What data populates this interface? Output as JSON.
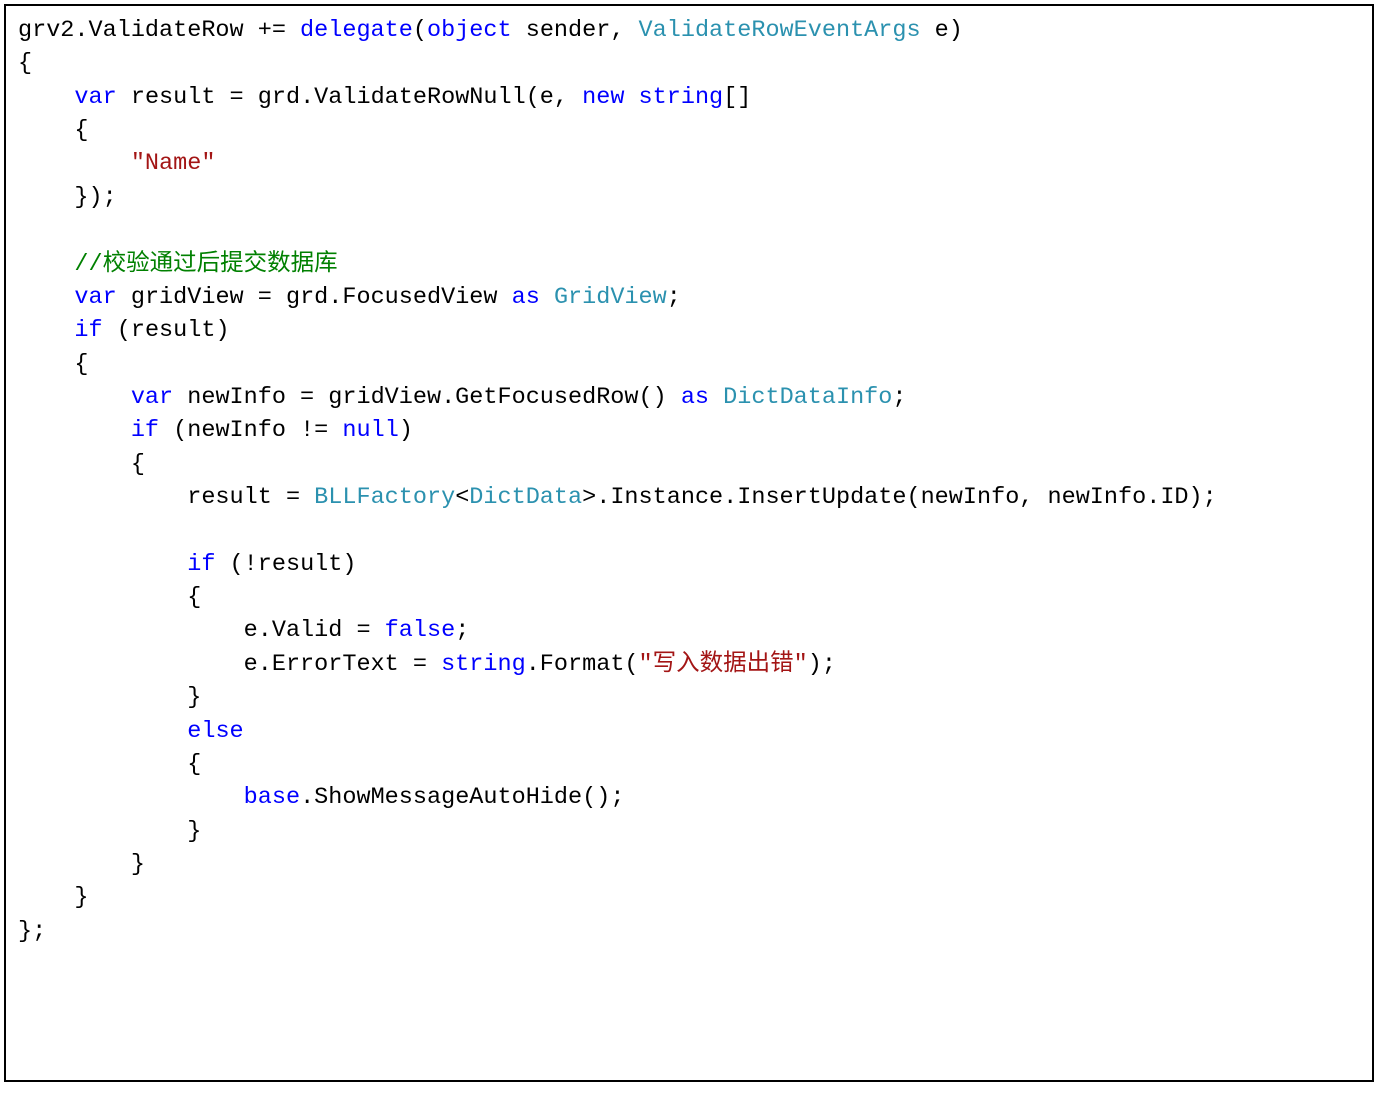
{
  "code": {
    "tokens": [
      [
        {
          "t": "grv2.ValidateRow += ",
          "c": ""
        },
        {
          "t": "delegate",
          "c": "kw"
        },
        {
          "t": "(",
          "c": ""
        },
        {
          "t": "object",
          "c": "kw"
        },
        {
          "t": " sender, ",
          "c": ""
        },
        {
          "t": "ValidateRowEventArgs",
          "c": "type"
        },
        {
          "t": " e)",
          "c": ""
        }
      ],
      [
        {
          "t": "{",
          "c": ""
        }
      ],
      [
        {
          "t": "    ",
          "c": ""
        },
        {
          "t": "var",
          "c": "kw"
        },
        {
          "t": " result = grd.ValidateRowNull(e, ",
          "c": ""
        },
        {
          "t": "new",
          "c": "kw"
        },
        {
          "t": " ",
          "c": ""
        },
        {
          "t": "string",
          "c": "kw"
        },
        {
          "t": "[]",
          "c": ""
        }
      ],
      [
        {
          "t": "    {",
          "c": ""
        }
      ],
      [
        {
          "t": "        ",
          "c": ""
        },
        {
          "t": "\"Name\"",
          "c": "str"
        }
      ],
      [
        {
          "t": "    });",
          "c": ""
        }
      ],
      [
        {
          "t": "",
          "c": ""
        }
      ],
      [
        {
          "t": "    ",
          "c": ""
        },
        {
          "t": "//校验通过后提交数据库",
          "c": "comment"
        }
      ],
      [
        {
          "t": "    ",
          "c": ""
        },
        {
          "t": "var",
          "c": "kw"
        },
        {
          "t": " gridView = grd.FocusedView ",
          "c": ""
        },
        {
          "t": "as",
          "c": "kw"
        },
        {
          "t": " ",
          "c": ""
        },
        {
          "t": "GridView",
          "c": "type"
        },
        {
          "t": ";",
          "c": ""
        }
      ],
      [
        {
          "t": "    ",
          "c": ""
        },
        {
          "t": "if",
          "c": "kw"
        },
        {
          "t": " (result)",
          "c": ""
        }
      ],
      [
        {
          "t": "    {",
          "c": ""
        }
      ],
      [
        {
          "t": "        ",
          "c": ""
        },
        {
          "t": "var",
          "c": "kw"
        },
        {
          "t": " newInfo = gridView.GetFocusedRow() ",
          "c": ""
        },
        {
          "t": "as",
          "c": "kw"
        },
        {
          "t": " ",
          "c": ""
        },
        {
          "t": "DictDataInfo",
          "c": "type"
        },
        {
          "t": ";",
          "c": ""
        }
      ],
      [
        {
          "t": "        ",
          "c": ""
        },
        {
          "t": "if",
          "c": "kw"
        },
        {
          "t": " (newInfo != ",
          "c": ""
        },
        {
          "t": "null",
          "c": "kw"
        },
        {
          "t": ")",
          "c": ""
        }
      ],
      [
        {
          "t": "        {",
          "c": ""
        }
      ],
      [
        {
          "t": "            result = ",
          "c": ""
        },
        {
          "t": "BLLFactory",
          "c": "type"
        },
        {
          "t": "<",
          "c": ""
        },
        {
          "t": "DictData",
          "c": "type"
        },
        {
          "t": ">.Instance.InsertUpdate(newInfo, newInfo.ID);",
          "c": ""
        }
      ],
      [
        {
          "t": "",
          "c": ""
        }
      ],
      [
        {
          "t": "            ",
          "c": ""
        },
        {
          "t": "if",
          "c": "kw"
        },
        {
          "t": " (!result)",
          "c": ""
        }
      ],
      [
        {
          "t": "            {",
          "c": ""
        }
      ],
      [
        {
          "t": "                e.Valid = ",
          "c": ""
        },
        {
          "t": "false",
          "c": "kw"
        },
        {
          "t": ";",
          "c": ""
        }
      ],
      [
        {
          "t": "                e.ErrorText = ",
          "c": ""
        },
        {
          "t": "string",
          "c": "kw"
        },
        {
          "t": ".Format(",
          "c": ""
        },
        {
          "t": "\"写入数据出错\"",
          "c": "str"
        },
        {
          "t": ");",
          "c": ""
        }
      ],
      [
        {
          "t": "            }",
          "c": ""
        }
      ],
      [
        {
          "t": "            ",
          "c": ""
        },
        {
          "t": "else",
          "c": "kw"
        }
      ],
      [
        {
          "t": "            {",
          "c": ""
        }
      ],
      [
        {
          "t": "                ",
          "c": ""
        },
        {
          "t": "base",
          "c": "kw"
        },
        {
          "t": ".ShowMessageAutoHide();",
          "c": ""
        }
      ],
      [
        {
          "t": "            }",
          "c": ""
        }
      ],
      [
        {
          "t": "        }",
          "c": ""
        }
      ],
      [
        {
          "t": "    }",
          "c": ""
        }
      ],
      [
        {
          "t": "};",
          "c": ""
        }
      ]
    ]
  }
}
